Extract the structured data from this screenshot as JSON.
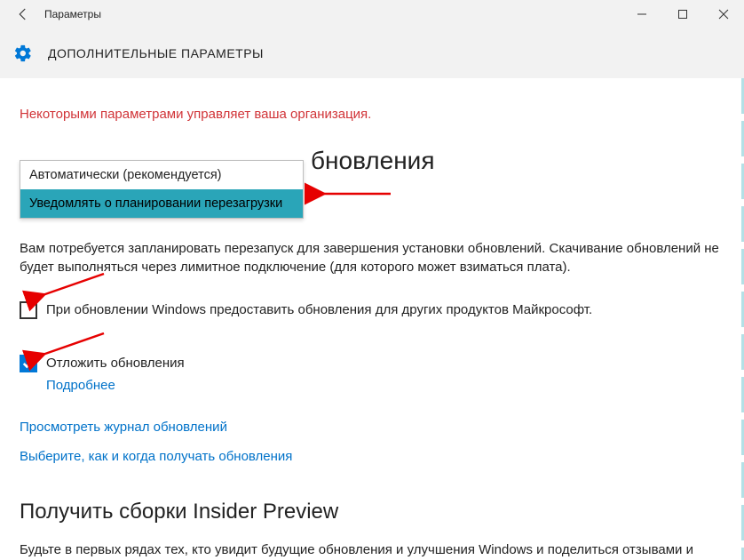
{
  "titlebar": {
    "title": "Параметры"
  },
  "header": {
    "title": "ДОПОЛНИТЕЛЬНЫЕ ПАРАМЕТРЫ"
  },
  "orgmsg": "Некоторыми параметрами управляет ваша организация.",
  "sectionTitleVisiblePart": "бновления",
  "dropdown": {
    "opt_auto": "Автоматически (рекомендуется)",
    "opt_notify": "Уведомлять о планировании перезагрузки"
  },
  "desc": "Вам потребуется запланировать перезапуск для завершения установки обновлений. Скачивание обновлений не будет выполняться через лимитное подключение (для которого может взиматься плата).",
  "checkbox1": {
    "label": "При обновлении Windows предоставить обновления для других продуктов Майкрософт."
  },
  "checkbox2": {
    "label": "Отложить обновления",
    "more": "Подробнее"
  },
  "link_history": "Просмотреть журнал обновлений",
  "link_choose": "Выберите, как и когда получать обновления",
  "insider": {
    "title": "Получить сборки Insider Preview",
    "body": "Будьте в первых рядах тех, кто увидит будущие обновления и улучшения Windows и поделиться отзывами и"
  }
}
